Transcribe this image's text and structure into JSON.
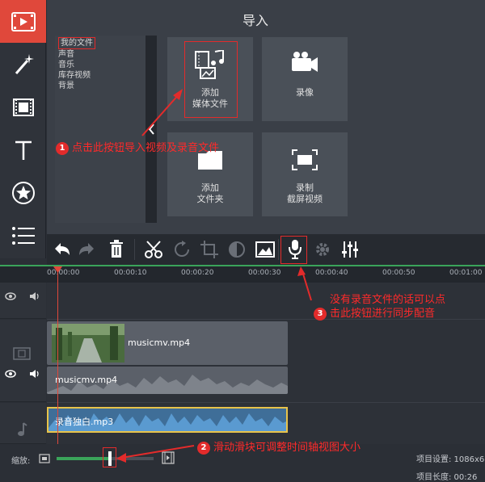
{
  "import_panel": {
    "title": "导入",
    "file_list": [
      "我的文件",
      "声音",
      "音乐",
      "库存视频",
      "背景"
    ],
    "tiles": [
      {
        "line1": "添加",
        "line2": "媒体文件"
      },
      {
        "line1": "录像",
        "line2": ""
      },
      {
        "line1": "添加",
        "line2": "文件夹"
      },
      {
        "line1": "录制",
        "line2": "截屏视频"
      }
    ]
  },
  "annotations": {
    "a1_num": "1",
    "a1_text": "点击此按钮导入视频及录音文件",
    "a2_num": "2",
    "a2_text": "滑动滑块可调整时间轴视图大小",
    "a3_num": "3",
    "a3_line1": "没有录音文件的话可以点",
    "a3_line2": "击此按钮进行同步配音"
  },
  "ruler": {
    "ticks": [
      "00:00:00",
      "00:00:10",
      "00:00:20",
      "00:00:30",
      "00:00:40",
      "00:00:50",
      "00:01:00"
    ]
  },
  "timeline": {
    "video_clip": "musicmv.mp4",
    "audio_of_video": "musicmv.mp4",
    "voice_clip": "录音独白.mp3"
  },
  "bottom": {
    "zoom_label": "缩放:",
    "project_settings": "项目设置:  1086x6",
    "project_length": "项目长度:  00:26"
  },
  "colors": {
    "accent": "#e0483b",
    "annotation": "#ff2a2a",
    "audio_wave": "#4a8cc8",
    "playhead": "#e0483b"
  }
}
